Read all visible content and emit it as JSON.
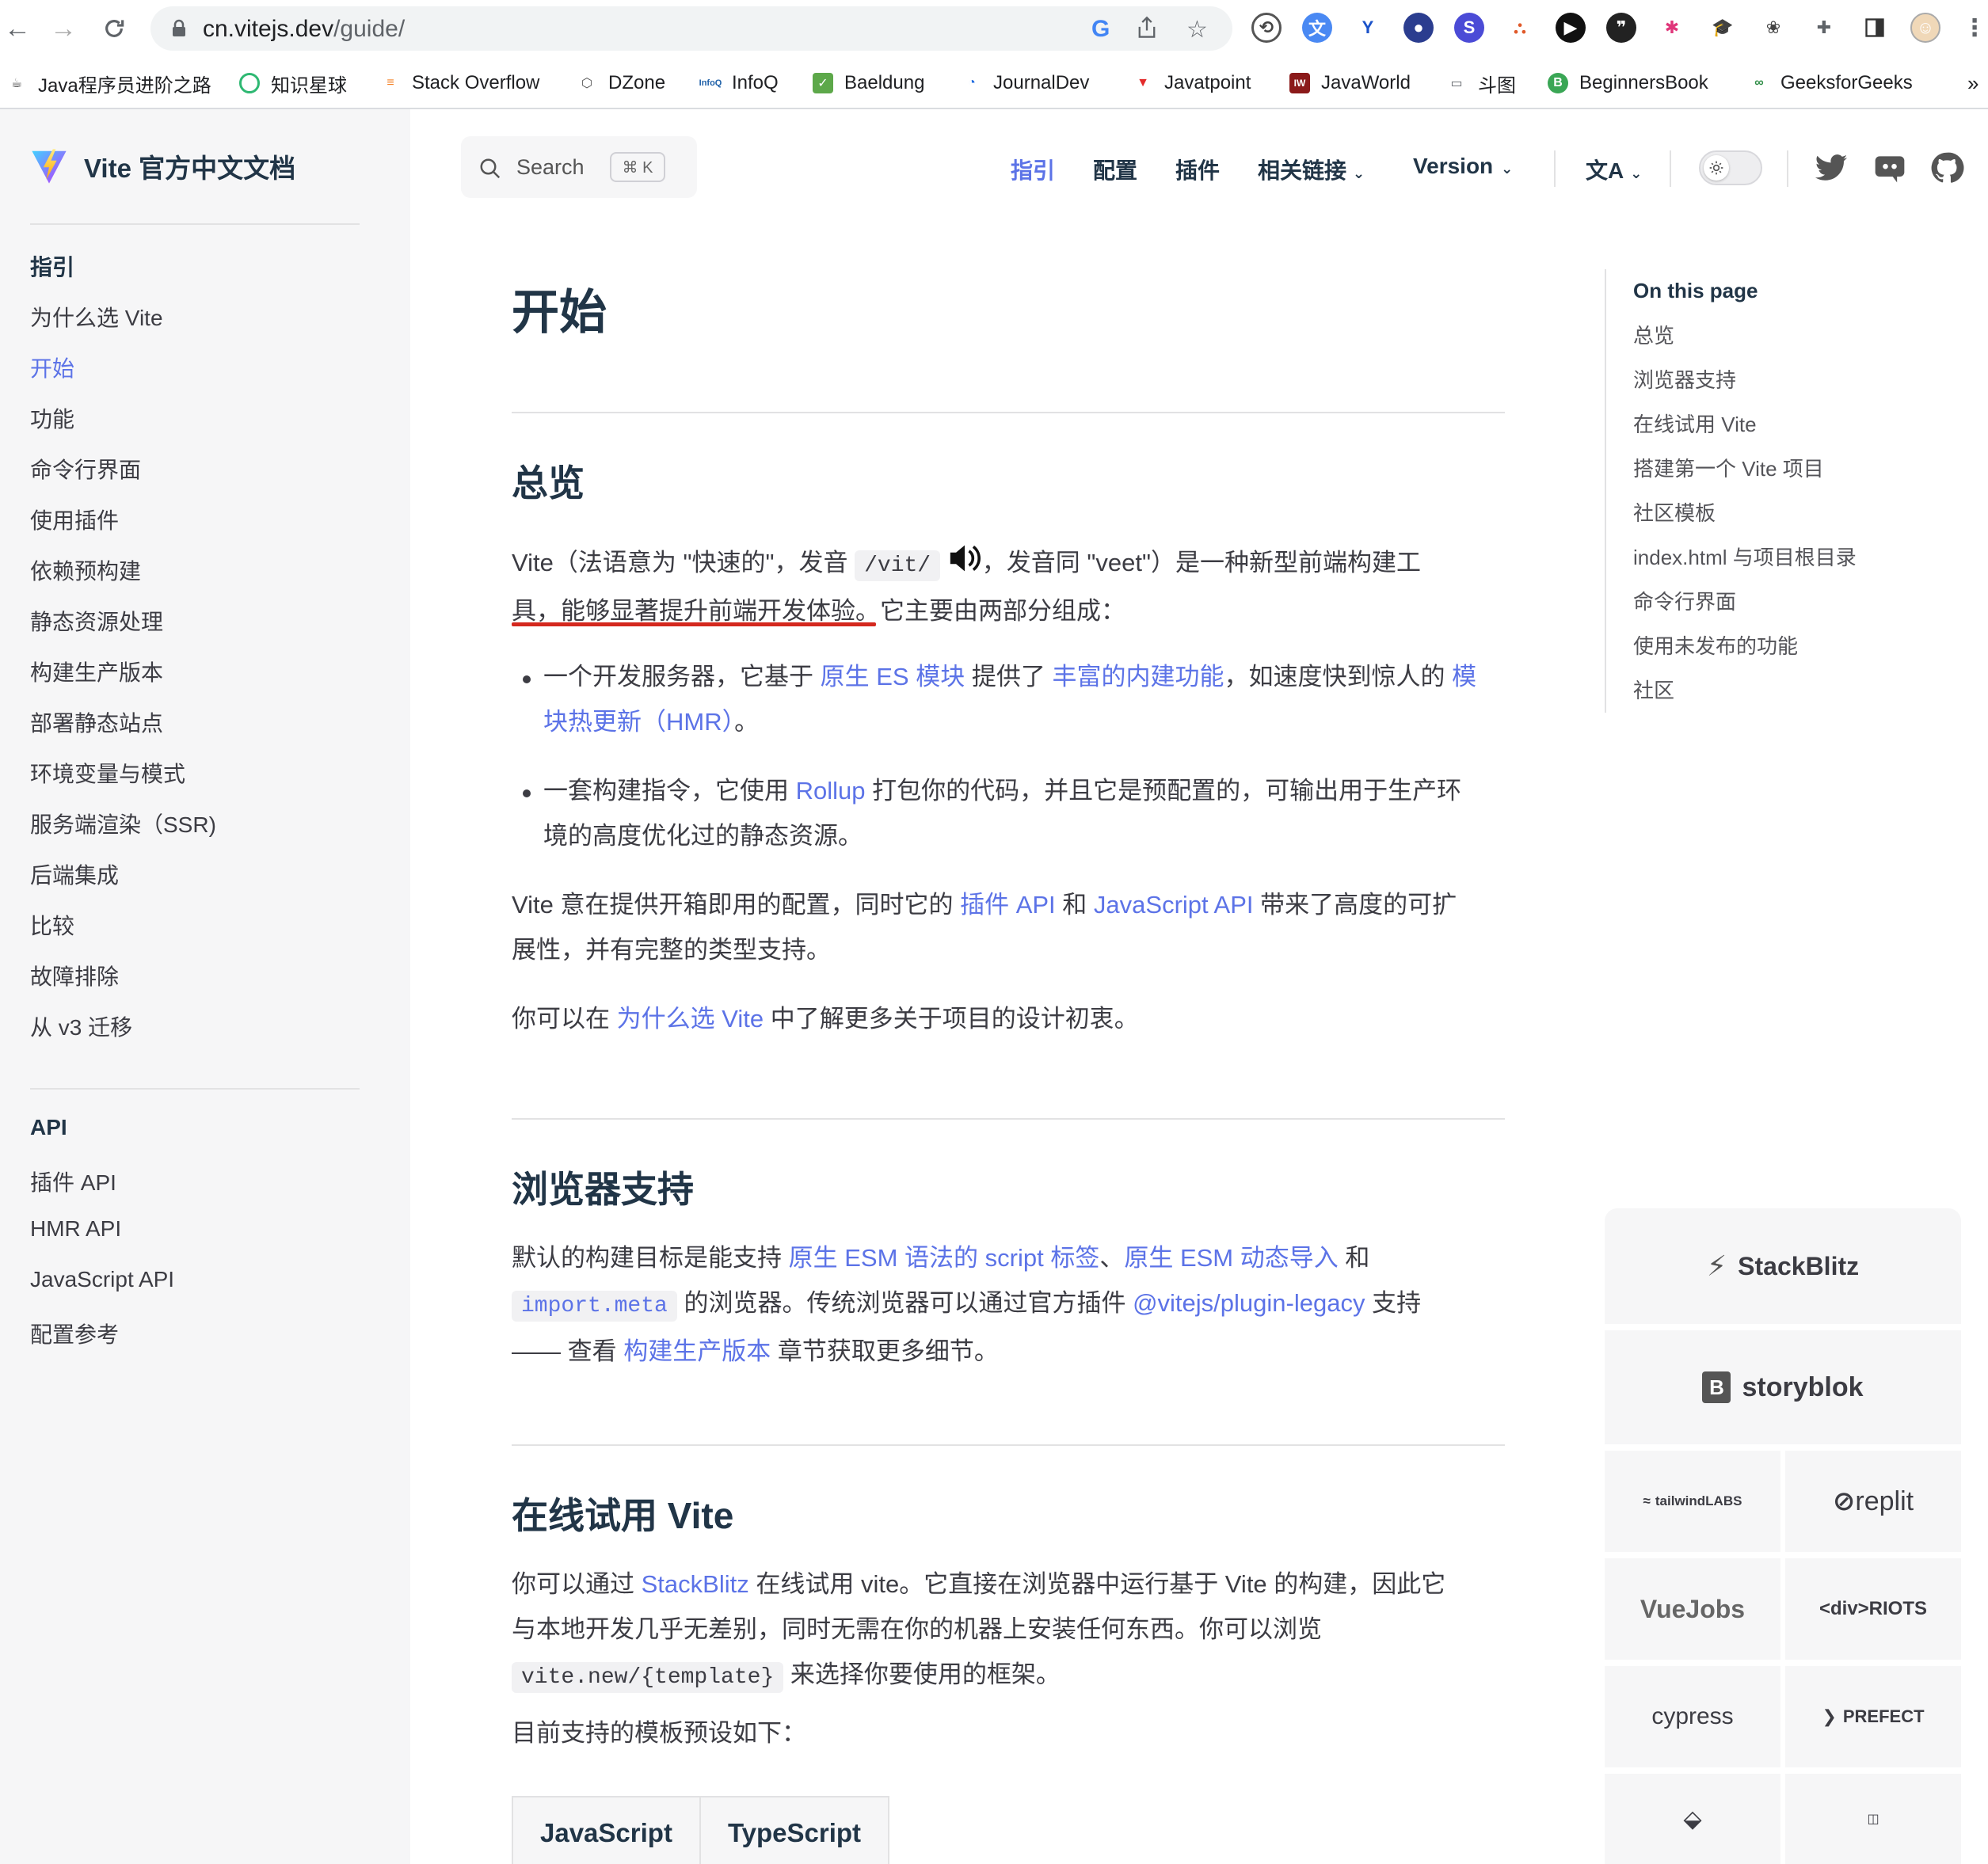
{
  "browser": {
    "url_host": "cn.vitejs.dev",
    "url_path": "/guide/",
    "bookmarks": [
      "Java程序员进阶之路",
      "知识星球",
      "Stack Overflow",
      "DZone",
      "InfoQ",
      "Baeldung",
      "JournalDev",
      "Javatpoint",
      "JavaWorld",
      "斗图",
      "BeginnersBook",
      "GeeksforGeeks"
    ],
    "more_bookmarks": "»"
  },
  "site": {
    "title": "Vite 官方中文文档",
    "search_label": "Search",
    "search_shortcut": "⌘ K",
    "nav": {
      "guide": "指引",
      "config": "配置",
      "plugins": "插件",
      "links": "相关链接",
      "version": "Version"
    }
  },
  "sidebar": {
    "guide_heading": "指引",
    "guide_items": [
      "为什么选 Vite",
      "开始",
      "功能",
      "命令行界面",
      "使用插件",
      "依赖预构建",
      "静态资源处理",
      "构建生产版本",
      "部署静态站点",
      "环境变量与模式",
      "服务端渲染（SSR)",
      "后端集成",
      "比较",
      "故障排除",
      "从 v3 迁移"
    ],
    "active_index": 1,
    "api_heading": "API",
    "api_items": [
      "插件 API",
      "HMR API",
      "JavaScript API",
      "配置参考"
    ]
  },
  "content": {
    "h1": "开始",
    "overview": {
      "h2": "总览",
      "p1_a": "Vite（法语意为 \"快速的\"，发音 ",
      "p1_code": "/vit/",
      "p1_b": "，发音同 \"veet\"）是一种新型前端构建工",
      "p1_c": "具，能够显著提升前端开发体验",
      "p1_d": "。它主要由两部分组成：",
      "li1_a": "一个开发服务器，它基于 ",
      "li1_link1": "原生 ES 模块",
      "li1_b": " 提供了 ",
      "li1_link2": "丰富的内建功能",
      "li1_c": "，如速度快到惊人的 ",
      "li1_link3a": "模",
      "li1_link3b": "块热更新（HMR）",
      "li1_d": "。",
      "li2_a": "一套构建指令，它使用 ",
      "li2_link": "Rollup",
      "li2_b": " 打包你的代码，并且它是预配置的，可输出用于生产环",
      "li2_c": "境的高度优化过的静态资源。",
      "p2_a": "Vite 意在提供开箱即用的配置，同时它的 ",
      "p2_link1": "插件 API",
      "p2_b": " 和 ",
      "p2_link2": "JavaScript API",
      "p2_c": " 带来了高度的可扩",
      "p2_d": "展性，并有完整的类型支持。",
      "p3_a": "你可以在 ",
      "p3_link": "为什么选 Vite",
      "p3_b": " 中了解更多关于项目的设计初衷。"
    },
    "browser_support": {
      "h2": "浏览器支持",
      "p_a": "默认的构建目标是能支持 ",
      "p_link1": "原生 ESM 语法的 script 标签",
      "p_sep": "、",
      "p_link2": "原生 ESM 动态导入",
      "p_b": " 和",
      "p_code": "import.meta",
      "p_c": " 的浏览器。传统浏览器可以通过官方插件 ",
      "p_link3": "@vitejs/plugin-legacy",
      "p_d": " 支持",
      "p_e": "—— 查看 ",
      "p_link4": "构建生产版本",
      "p_f": " 章节获取更多细节。"
    },
    "try_online": {
      "h2": "在线试用 Vite",
      "p_a": "你可以通过 ",
      "p_link": "StackBlitz",
      "p_b": " 在线试用 vite。它直接在浏览器中运行基于 Vite 的构建，因此它",
      "p_c": "与本地开发几乎无差别，同时无需在你的机器上安装任何东西。你可以浏览",
      "p_code": "vite.new/{template}",
      "p_d": " 来选择你要使用的框架。",
      "p2": "目前支持的模板预设如下：",
      "table_headers": [
        "JavaScript",
        "TypeScript"
      ]
    }
  },
  "outline": {
    "title": "On this page",
    "items": [
      "总览",
      "浏览器支持",
      "在线试用 Vite",
      "搭建第一个 Vite 项目",
      "社区模板",
      "index.html 与项目根目录",
      "命令行界面",
      "使用未发布的功能",
      "社区"
    ]
  },
  "sponsors": {
    "big": [
      "StackBlitz",
      "storyblok"
    ],
    "small": [
      "tailwindLABS",
      "replit",
      "VueJobs",
      "<div>RIOTS",
      "cypress",
      "PREFECT"
    ]
  },
  "colors": {
    "brand": "#5c73e7",
    "sidebar_bg": "#f6f6f7",
    "annotation": "#d4281e"
  }
}
